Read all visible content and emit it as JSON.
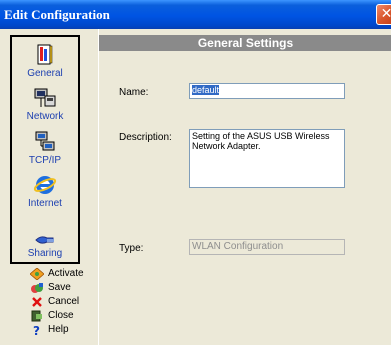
{
  "window": {
    "title": "Edit Configuration",
    "close_glyph": "✕"
  },
  "sidebar": {
    "nav": [
      {
        "label": "General",
        "icon": "general-icon"
      },
      {
        "label": "Network",
        "icon": "network-icon"
      },
      {
        "label": "TCP/IP",
        "icon": "tcpip-icon"
      },
      {
        "label": "Internet",
        "icon": "internet-icon"
      },
      {
        "label": "Sharing",
        "icon": "sharing-icon"
      }
    ],
    "actions": [
      {
        "label": "Activate",
        "icon": "activate-icon"
      },
      {
        "label": "Save",
        "icon": "save-icon"
      },
      {
        "label": "Cancel",
        "icon": "cancel-icon"
      },
      {
        "label": "Close",
        "icon": "close-icon"
      },
      {
        "label": "Help",
        "icon": "help-icon"
      }
    ]
  },
  "main": {
    "header": "General Settings",
    "fields": {
      "name_label": "Name:",
      "name_value": "default",
      "description_label": "Description:",
      "description_value": "Setting of the ASUS USB Wireless Network Adapter.",
      "type_label": "Type:",
      "type_value": "WLAN Configuration"
    }
  },
  "colors": {
    "title_bar": "#0054e3",
    "header_bar": "#8a8a8a",
    "nav_text": "#1c3fb0"
  }
}
